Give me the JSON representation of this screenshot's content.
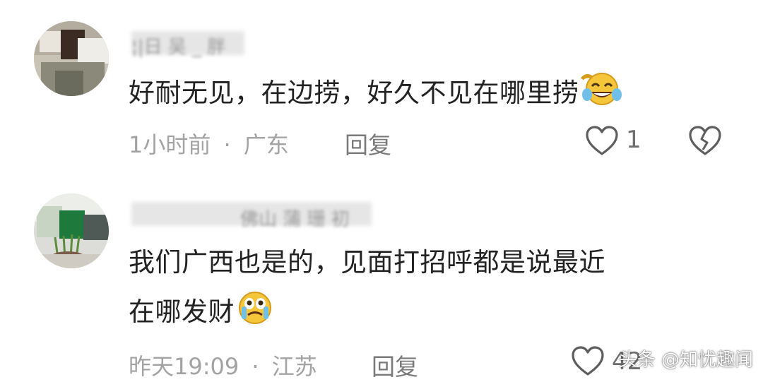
{
  "comments": [
    {
      "username": "¦|日 吴 _ 胖",
      "text": "好耐无见，在边捞，好久不见在哪里捞",
      "emoji": "laughing-crying-emoji",
      "time": "1小时前",
      "separator": "·",
      "location": "广东",
      "reply_label": "回复",
      "likes": "1"
    },
    {
      "username": "佛山 蒲 珊 初",
      "text_line1": "我们广西也是的，见面打招呼都是说最近",
      "text_line2": "在哪发财",
      "emoji": "crying-emoji",
      "time": "昨天19:09",
      "separator": "·",
      "location": "江苏",
      "reply_label": "回复",
      "likes": "42"
    }
  ],
  "watermark": "头条 @知忧趣闻",
  "colors": {
    "text": "#222222",
    "meta": "#a3a3a3",
    "icon": "#5e5e5e"
  }
}
